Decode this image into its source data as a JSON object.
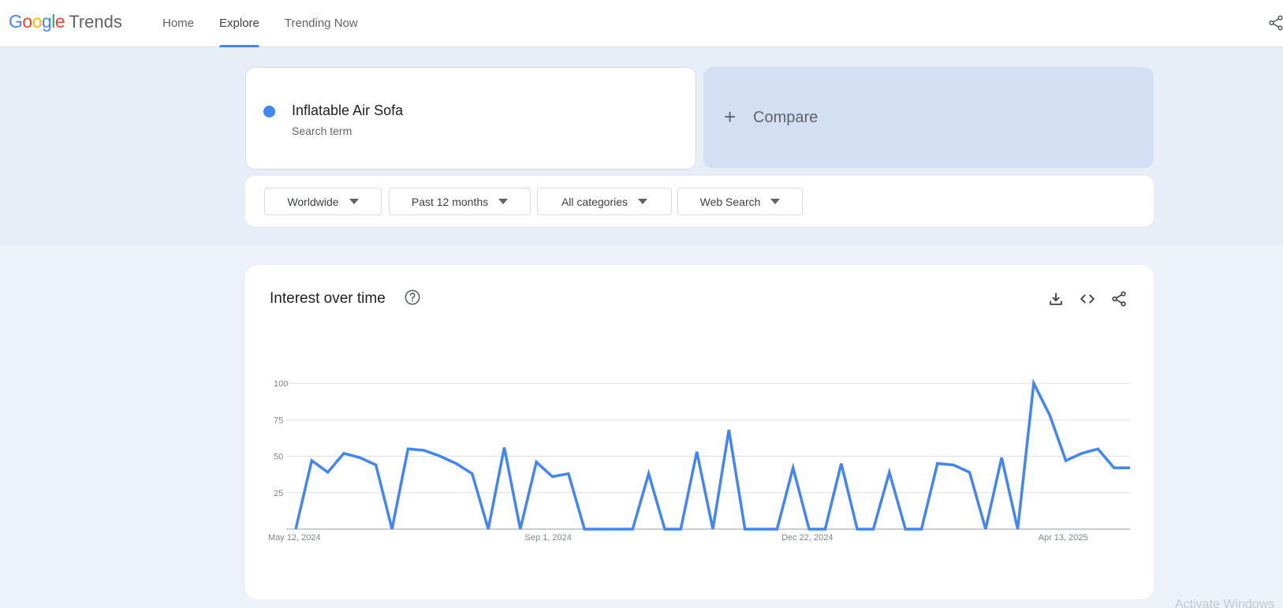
{
  "header": {
    "logo_google": [
      "G",
      "o",
      "o",
      "g",
      "l",
      "e"
    ],
    "logo_trends": "Trends",
    "nav": [
      {
        "label": "Home",
        "active": false
      },
      {
        "label": "Explore",
        "active": true
      },
      {
        "label": "Trending Now",
        "active": false
      }
    ],
    "share_icon": "share-icon"
  },
  "search_term": {
    "name": "Inflatable Air Sofa",
    "subtitle": "Search term",
    "color": "#4285f4"
  },
  "compare": {
    "icon": "+",
    "label": "Compare"
  },
  "filters": [
    {
      "label": "Worldwide"
    },
    {
      "label": "Past 12 months"
    },
    {
      "label": "All categories"
    },
    {
      "label": "Web Search"
    }
  ],
  "chart_card": {
    "title": "Interest over time",
    "icons": [
      "help-icon",
      "download-icon",
      "embed-icon",
      "share-icon"
    ]
  },
  "chart_data": {
    "type": "line",
    "title": "Interest over time",
    "xlabel": "",
    "ylabel": "",
    "ylim": [
      0,
      100
    ],
    "yticks": [
      25,
      50,
      75,
      100
    ],
    "grid": true,
    "x_tick_labels": [
      "May 12, 2024",
      "Sep 1, 2024",
      "Dec 22, 2024",
      "Apr 13, 2025"
    ],
    "x_tick_index": [
      0,
      16,
      32,
      48
    ],
    "series": [
      {
        "name": "Inflatable Air Sofa",
        "color": "#4285f4",
        "values": [
          0,
          47,
          39,
          52,
          49,
          44,
          0,
          55,
          54,
          50,
          45,
          38,
          0,
          56,
          0,
          46,
          36,
          38,
          0,
          0,
          0,
          0,
          38,
          0,
          0,
          53,
          0,
          68,
          0,
          0,
          0,
          42,
          0,
          0,
          45,
          0,
          0,
          39,
          0,
          0,
          45,
          44,
          39,
          0,
          49,
          0,
          100,
          78,
          47,
          52,
          55,
          42,
          42
        ]
      }
    ]
  },
  "watermark": "Activate Windows"
}
